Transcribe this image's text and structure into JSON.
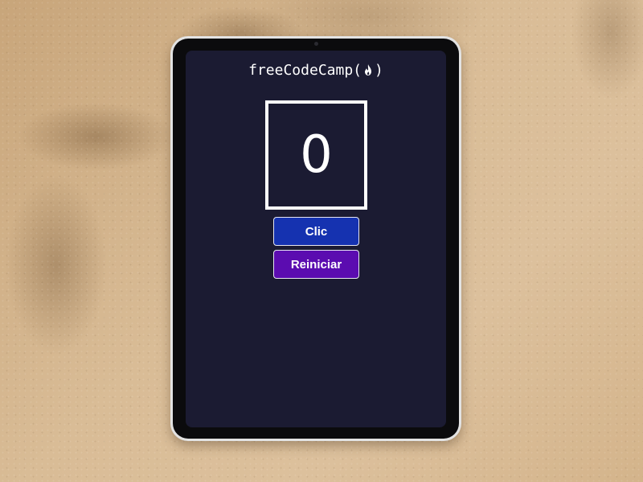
{
  "app": {
    "brand_text": "freeCodeCamp(",
    "brand_text_end": ")"
  },
  "counter": {
    "value": "0"
  },
  "buttons": {
    "click_label": "Clic",
    "reset_label": "Reiniciar"
  },
  "colors": {
    "screen_bg": "#1b1b32",
    "click_button": "#1532b0",
    "reset_button": "#5b0cb0",
    "text": "#ffffff"
  },
  "icons": {
    "brand_icon": "fire-icon"
  }
}
